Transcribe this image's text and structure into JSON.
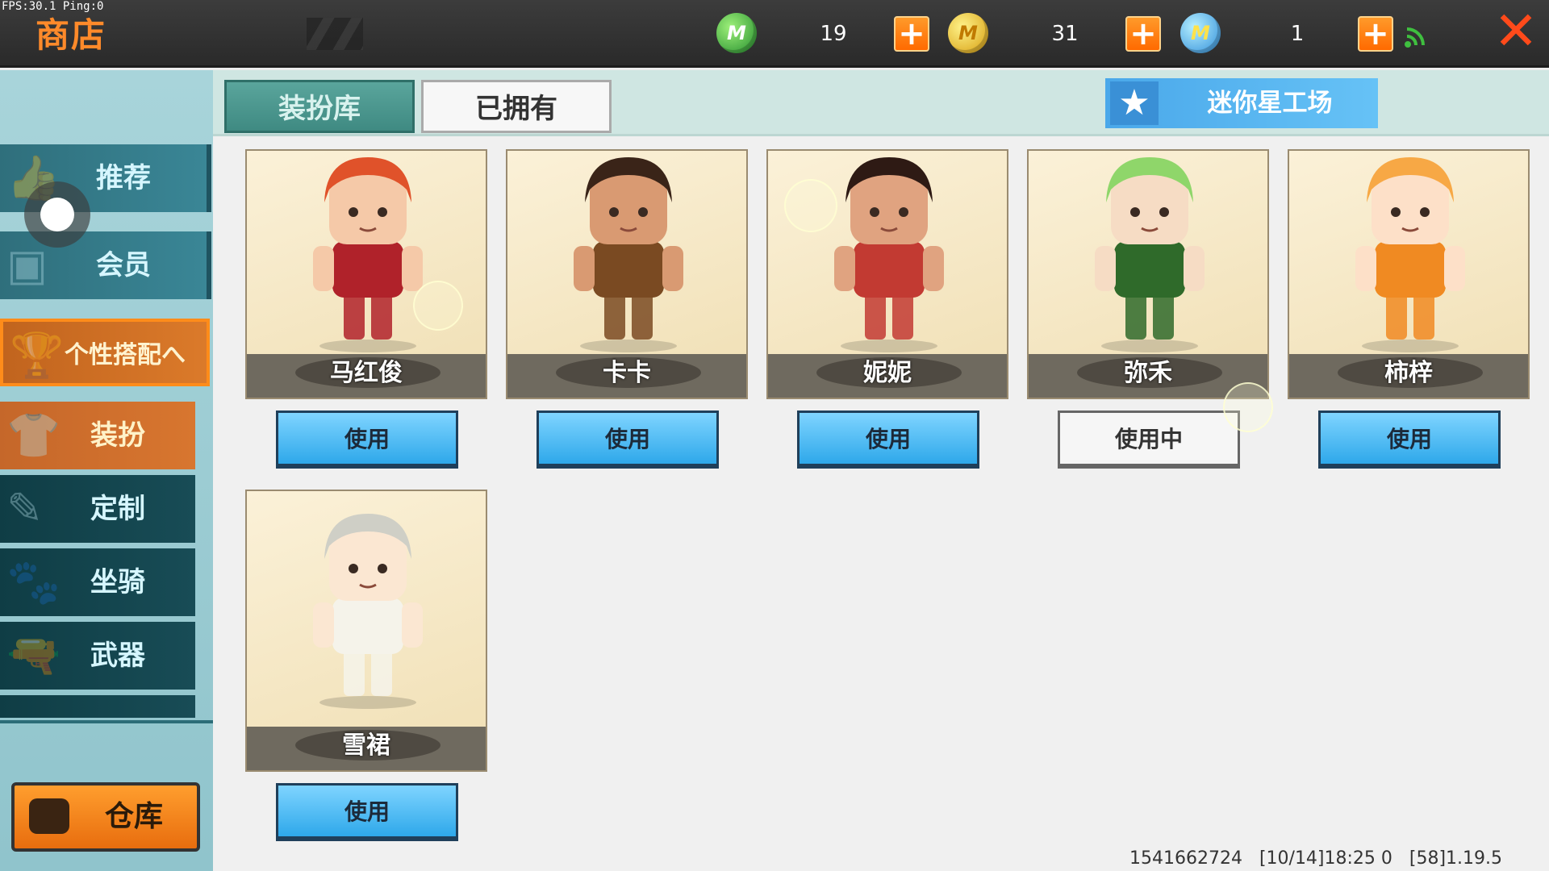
{
  "debug": {
    "fps": "FPS:30.1  Ping:0"
  },
  "header": {
    "title": "商店"
  },
  "currencies": [
    {
      "icon": "green-m-coin-icon",
      "value": "19"
    },
    {
      "icon": "gold-coin-icon",
      "value": "31"
    },
    {
      "icon": "blue-m-coin-icon",
      "value": "1"
    }
  ],
  "sidebar": {
    "items": [
      {
        "label": "推荐",
        "icon": "thumbs-up-icon"
      },
      {
        "label": "会员",
        "icon": "member-card-icon"
      },
      {
        "label": "个性搭配へ",
        "icon": "trophy-icon"
      },
      {
        "label": "装扮",
        "icon": "shirt-icon"
      },
      {
        "label": "定制",
        "icon": "pencil-icon"
      },
      {
        "label": "坐骑",
        "icon": "mount-icon"
      },
      {
        "label": "武器",
        "icon": "gun-icon"
      }
    ],
    "warehouse_label": "仓库"
  },
  "tabs": {
    "first": "装扮库",
    "second": "已拥有"
  },
  "workshop_label": "迷你星工场",
  "cards": [
    {
      "name": "马红俊",
      "button": "使用",
      "colors": {
        "hair": "#e0522a",
        "body": "#b0222a",
        "skin": "#f5c9a8"
      }
    },
    {
      "name": "卡卡",
      "button": "使用",
      "colors": {
        "hair": "#3a2418",
        "body": "#7a4a22",
        "skin": "#d99a72"
      }
    },
    {
      "name": "妮妮",
      "button": "使用",
      "colors": {
        "hair": "#2e1a14",
        "body": "#c23a32",
        "skin": "#e0a380"
      }
    },
    {
      "name": "弥禾",
      "button": "使用中",
      "colors": {
        "hair": "#8fd66a",
        "body": "#2f6a2a",
        "skin": "#f6dcc4"
      }
    },
    {
      "name": "柿梓",
      "button": "使用",
      "colors": {
        "hair": "#f7a845",
        "body": "#f08a22",
        "skin": "#fde0c8"
      }
    },
    {
      "name": "雪裙",
      "button": "使用",
      "colors": {
        "hair": "#cfcfc6",
        "body": "#f5f3ea",
        "skin": "#fbe7d2"
      }
    }
  ],
  "footer": {
    "info": "1541662724   [10/14]18:25 0   [58]1.19.5"
  }
}
